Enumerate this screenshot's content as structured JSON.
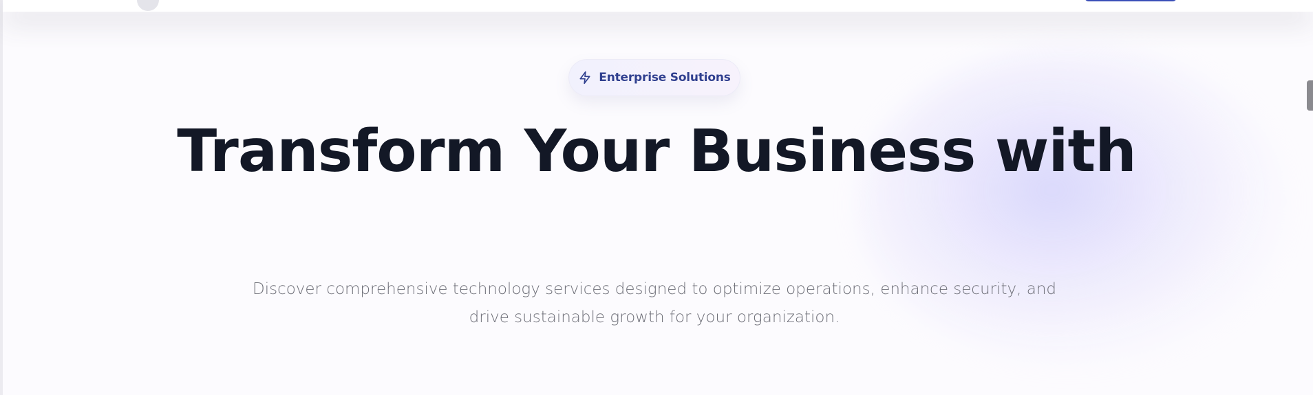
{
  "badge": {
    "label": "Enterprise Solutions",
    "icon": "lightning-bolt-icon"
  },
  "hero": {
    "headline": "Transform Your Business with",
    "description": "Discover comprehensive technology services designed to optimize operations, enhance security, and drive sustainable growth for your organization."
  },
  "colors": {
    "accent": "#30408f",
    "headline": "#131826",
    "body_text": "#6e6f78",
    "background": "#fcfbfe",
    "glow": "#cfccfa",
    "nav_button": "#3b4fb8"
  }
}
